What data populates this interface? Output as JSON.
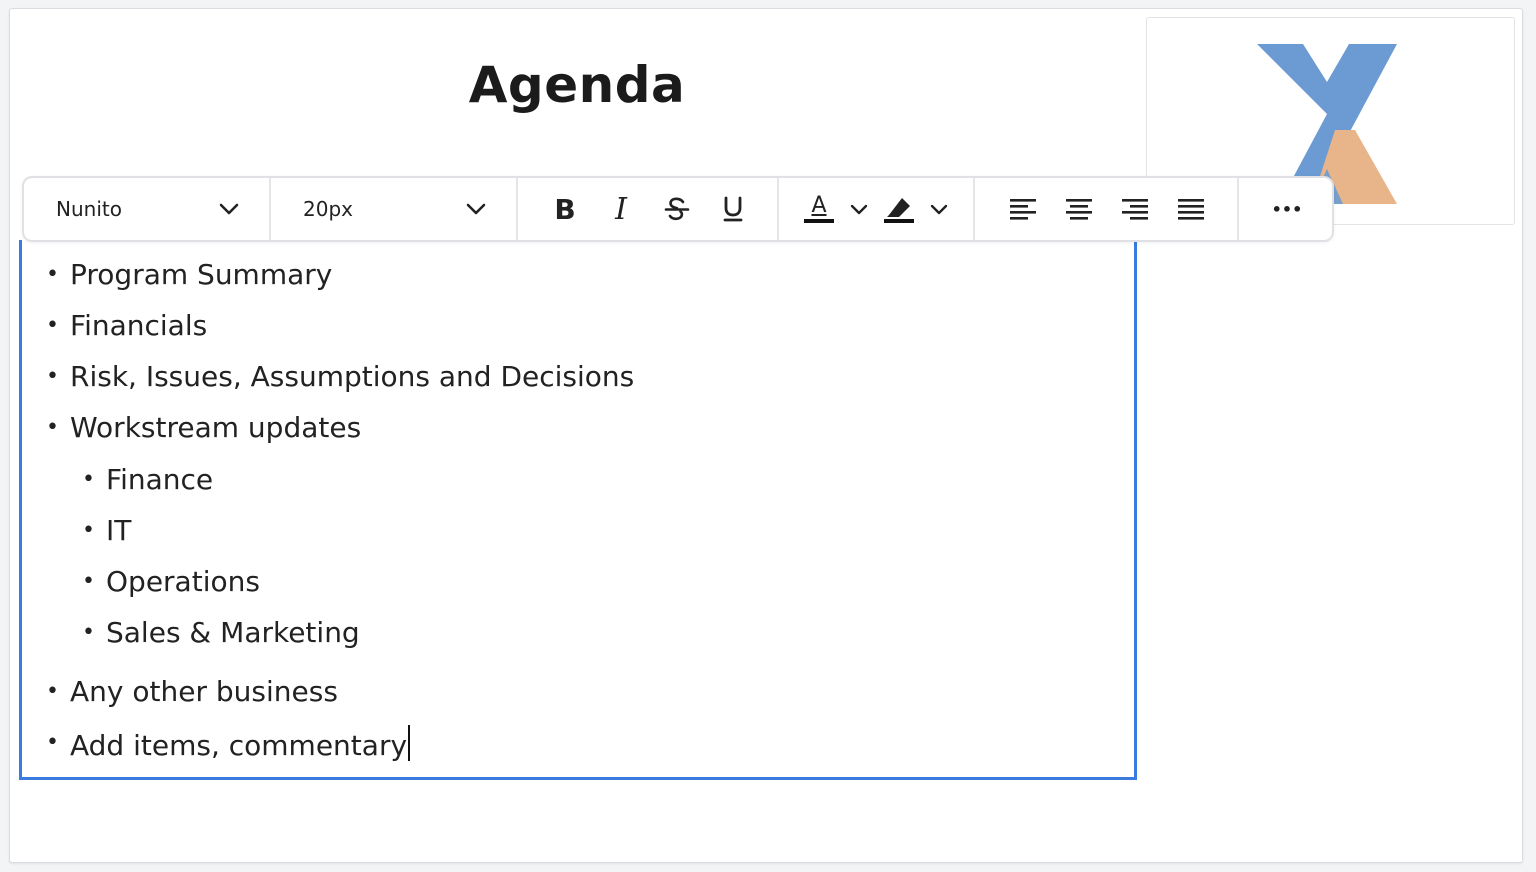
{
  "slide": {
    "title": "Agenda"
  },
  "logo": {
    "icon": "xa-logo",
    "colors": {
      "blue": "#6b9bd2",
      "orange": "#e8b48a"
    }
  },
  "toolbar": {
    "font_family": "Nunito",
    "font_size": "20px",
    "bold_glyph": "B",
    "italic_glyph": "I",
    "text_color_glyph": "A",
    "more_glyph": "•••"
  },
  "editor": {
    "accent": "#3a7be0",
    "items": [
      "Program Summary",
      "Financials",
      "Risk, Issues, Assumptions and Decisions",
      "Workstream updates"
    ],
    "subitems": [
      "Finance",
      "IT",
      "Operations",
      "Sales & Marketing"
    ],
    "tail_items": [
      "Any other business",
      "Add items, commentary"
    ]
  }
}
